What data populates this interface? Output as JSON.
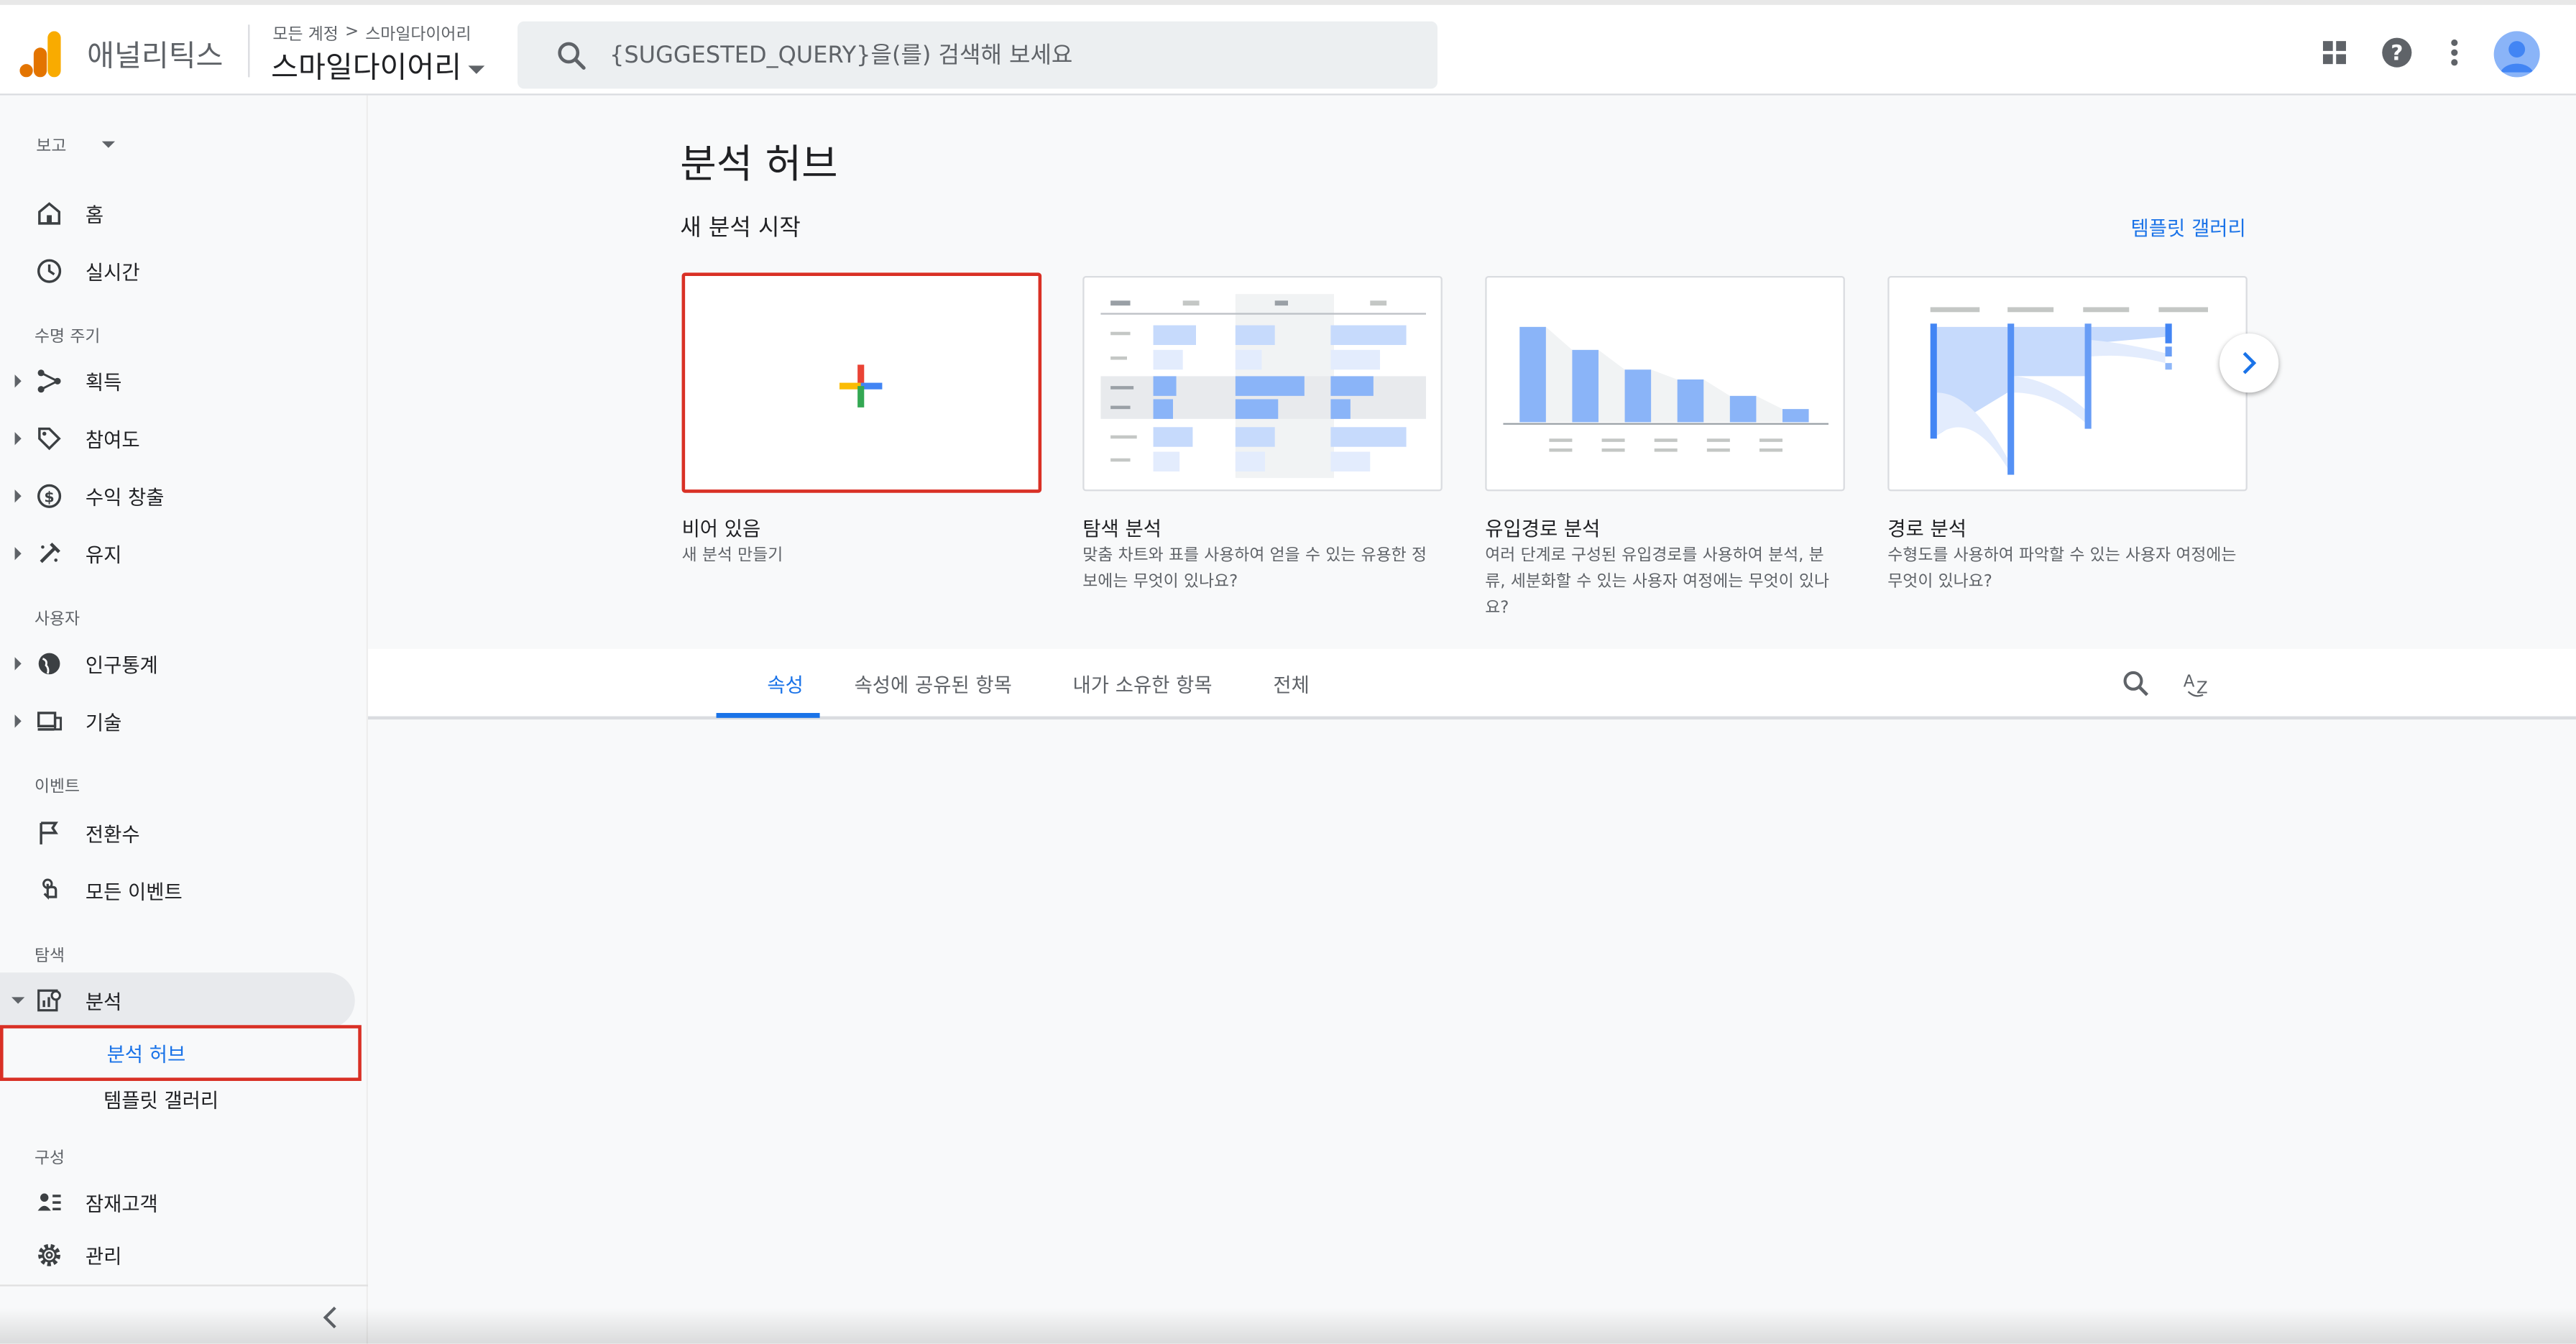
{
  "header": {
    "app_name": "애널리틱스",
    "breadcrumb": [
      "모든 계정",
      "스마일다이어리"
    ],
    "breadcrumb_separator": ">",
    "property_name": "스마일다이어리",
    "search_placeholder": "{SUGGESTED_QUERY}을(를) 검색해 보세요",
    "icons": [
      "apps-grid-icon",
      "help-icon",
      "more-vert-icon",
      "account-avatar"
    ]
  },
  "sidebar": {
    "report_label": "보고",
    "items": [
      {
        "label": "홈",
        "icon": "home-icon"
      },
      {
        "label": "실시간",
        "icon": "clock-icon"
      },
      {
        "section": "수명 주기"
      },
      {
        "label": "획득",
        "icon": "acquisition-icon"
      },
      {
        "label": "참여도",
        "icon": "tag-icon"
      },
      {
        "label": "수익 창출",
        "icon": "dollar-icon"
      },
      {
        "label": "유지",
        "icon": "retention-icon"
      },
      {
        "section": "사용자"
      },
      {
        "label": "인구통계",
        "icon": "globe-icon"
      },
      {
        "label": "기술",
        "icon": "devices-icon"
      },
      {
        "section": "이벤트"
      },
      {
        "label": "전환수",
        "icon": "flag-icon"
      },
      {
        "label": "모든 이벤트",
        "icon": "touch-icon"
      },
      {
        "section": "탐색"
      },
      {
        "label": "분석",
        "icon": "analysis-icon"
      },
      {
        "sub": "분석 허브"
      },
      {
        "sub": "템플릿 갤러리"
      },
      {
        "section": "구성"
      },
      {
        "label": "잠재고객",
        "icon": "audience-icon"
      },
      {
        "label": "관리",
        "icon": "settings-icon"
      }
    ]
  },
  "main": {
    "title": "분석 허브",
    "subtitle": "새 분석 시작",
    "gallery_link": "템플릿 갤러리",
    "cards": [
      {
        "title": "비어 있음",
        "desc": "새 분석 만들기"
      },
      {
        "title": "탐색 분석",
        "desc": "맞춤 차트와 표를 사용하여 얻을 수 있는 유용한 정보에는 무엇이 있나요?"
      },
      {
        "title": "유입경로 분석",
        "desc": "여러 단계로 구성된 유입경로를 사용하여 분석, 분류, 세분화할 수 있는 사용자 여정에는 무엇이 있나요?"
      },
      {
        "title": "경로 분석",
        "desc": "수형도를 사용하여 파악할 수 있는 사용자 여정에는 무엇이 있나요?"
      }
    ],
    "tabs": [
      "속성",
      "속성에 공유된 항목",
      "내가 소유한 항목",
      "전체"
    ],
    "active_tab": "속성"
  },
  "colors": {
    "accent": "#1a73e8",
    "highlight_border": "#d93025",
    "logo_orange": "#f9ab00",
    "logo_dark_orange": "#e37400",
    "preview_blue": "#8ab4f8"
  }
}
